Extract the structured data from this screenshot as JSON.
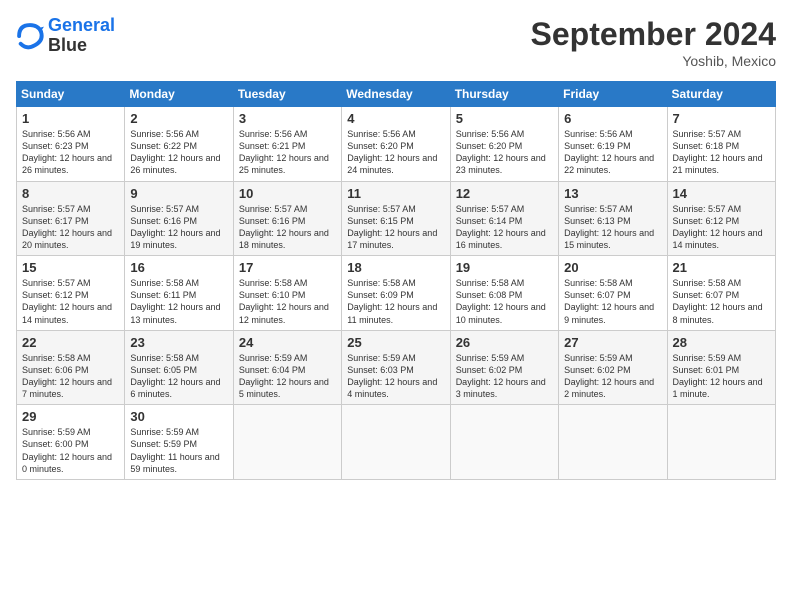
{
  "logo": {
    "line1": "General",
    "line2": "Blue"
  },
  "title": "September 2024",
  "location": "Yoshib, Mexico",
  "days_of_week": [
    "Sunday",
    "Monday",
    "Tuesday",
    "Wednesday",
    "Thursday",
    "Friday",
    "Saturday"
  ],
  "weeks": [
    [
      {
        "day": "1",
        "sunrise": "Sunrise: 5:56 AM",
        "sunset": "Sunset: 6:23 PM",
        "daylight": "Daylight: 12 hours and 26 minutes."
      },
      {
        "day": "2",
        "sunrise": "Sunrise: 5:56 AM",
        "sunset": "Sunset: 6:22 PM",
        "daylight": "Daylight: 12 hours and 26 minutes."
      },
      {
        "day": "3",
        "sunrise": "Sunrise: 5:56 AM",
        "sunset": "Sunset: 6:21 PM",
        "daylight": "Daylight: 12 hours and 25 minutes."
      },
      {
        "day": "4",
        "sunrise": "Sunrise: 5:56 AM",
        "sunset": "Sunset: 6:20 PM",
        "daylight": "Daylight: 12 hours and 24 minutes."
      },
      {
        "day": "5",
        "sunrise": "Sunrise: 5:56 AM",
        "sunset": "Sunset: 6:20 PM",
        "daylight": "Daylight: 12 hours and 23 minutes."
      },
      {
        "day": "6",
        "sunrise": "Sunrise: 5:56 AM",
        "sunset": "Sunset: 6:19 PM",
        "daylight": "Daylight: 12 hours and 22 minutes."
      },
      {
        "day": "7",
        "sunrise": "Sunrise: 5:57 AM",
        "sunset": "Sunset: 6:18 PM",
        "daylight": "Daylight: 12 hours and 21 minutes."
      }
    ],
    [
      {
        "day": "8",
        "sunrise": "Sunrise: 5:57 AM",
        "sunset": "Sunset: 6:17 PM",
        "daylight": "Daylight: 12 hours and 20 minutes."
      },
      {
        "day": "9",
        "sunrise": "Sunrise: 5:57 AM",
        "sunset": "Sunset: 6:16 PM",
        "daylight": "Daylight: 12 hours and 19 minutes."
      },
      {
        "day": "10",
        "sunrise": "Sunrise: 5:57 AM",
        "sunset": "Sunset: 6:16 PM",
        "daylight": "Daylight: 12 hours and 18 minutes."
      },
      {
        "day": "11",
        "sunrise": "Sunrise: 5:57 AM",
        "sunset": "Sunset: 6:15 PM",
        "daylight": "Daylight: 12 hours and 17 minutes."
      },
      {
        "day": "12",
        "sunrise": "Sunrise: 5:57 AM",
        "sunset": "Sunset: 6:14 PM",
        "daylight": "Daylight: 12 hours and 16 minutes."
      },
      {
        "day": "13",
        "sunrise": "Sunrise: 5:57 AM",
        "sunset": "Sunset: 6:13 PM",
        "daylight": "Daylight: 12 hours and 15 minutes."
      },
      {
        "day": "14",
        "sunrise": "Sunrise: 5:57 AM",
        "sunset": "Sunset: 6:12 PM",
        "daylight": "Daylight: 12 hours and 14 minutes."
      }
    ],
    [
      {
        "day": "15",
        "sunrise": "Sunrise: 5:57 AM",
        "sunset": "Sunset: 6:12 PM",
        "daylight": "Daylight: 12 hours and 14 minutes."
      },
      {
        "day": "16",
        "sunrise": "Sunrise: 5:58 AM",
        "sunset": "Sunset: 6:11 PM",
        "daylight": "Daylight: 12 hours and 13 minutes."
      },
      {
        "day": "17",
        "sunrise": "Sunrise: 5:58 AM",
        "sunset": "Sunset: 6:10 PM",
        "daylight": "Daylight: 12 hours and 12 minutes."
      },
      {
        "day": "18",
        "sunrise": "Sunrise: 5:58 AM",
        "sunset": "Sunset: 6:09 PM",
        "daylight": "Daylight: 12 hours and 11 minutes."
      },
      {
        "day": "19",
        "sunrise": "Sunrise: 5:58 AM",
        "sunset": "Sunset: 6:08 PM",
        "daylight": "Daylight: 12 hours and 10 minutes."
      },
      {
        "day": "20",
        "sunrise": "Sunrise: 5:58 AM",
        "sunset": "Sunset: 6:07 PM",
        "daylight": "Daylight: 12 hours and 9 minutes."
      },
      {
        "day": "21",
        "sunrise": "Sunrise: 5:58 AM",
        "sunset": "Sunset: 6:07 PM",
        "daylight": "Daylight: 12 hours and 8 minutes."
      }
    ],
    [
      {
        "day": "22",
        "sunrise": "Sunrise: 5:58 AM",
        "sunset": "Sunset: 6:06 PM",
        "daylight": "Daylight: 12 hours and 7 minutes."
      },
      {
        "day": "23",
        "sunrise": "Sunrise: 5:58 AM",
        "sunset": "Sunset: 6:05 PM",
        "daylight": "Daylight: 12 hours and 6 minutes."
      },
      {
        "day": "24",
        "sunrise": "Sunrise: 5:59 AM",
        "sunset": "Sunset: 6:04 PM",
        "daylight": "Daylight: 12 hours and 5 minutes."
      },
      {
        "day": "25",
        "sunrise": "Sunrise: 5:59 AM",
        "sunset": "Sunset: 6:03 PM",
        "daylight": "Daylight: 12 hours and 4 minutes."
      },
      {
        "day": "26",
        "sunrise": "Sunrise: 5:59 AM",
        "sunset": "Sunset: 6:02 PM",
        "daylight": "Daylight: 12 hours and 3 minutes."
      },
      {
        "day": "27",
        "sunrise": "Sunrise: 5:59 AM",
        "sunset": "Sunset: 6:02 PM",
        "daylight": "Daylight: 12 hours and 2 minutes."
      },
      {
        "day": "28",
        "sunrise": "Sunrise: 5:59 AM",
        "sunset": "Sunset: 6:01 PM",
        "daylight": "Daylight: 12 hours and 1 minute."
      }
    ],
    [
      {
        "day": "29",
        "sunrise": "Sunrise: 5:59 AM",
        "sunset": "Sunset: 6:00 PM",
        "daylight": "Daylight: 12 hours and 0 minutes."
      },
      {
        "day": "30",
        "sunrise": "Sunrise: 5:59 AM",
        "sunset": "Sunset: 5:59 PM",
        "daylight": "Daylight: 11 hours and 59 minutes."
      },
      null,
      null,
      null,
      null,
      null
    ]
  ]
}
